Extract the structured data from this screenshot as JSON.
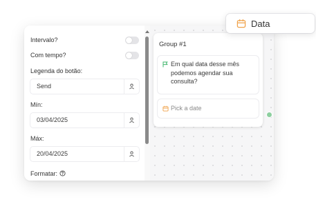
{
  "properties": {
    "interval_label": "Intervalo?",
    "with_time_label": "Com tempo?",
    "button_caption_label": "Legenda do botão:",
    "button_caption_value": "Send",
    "min_label": "Mín:",
    "min_value": "03/04/2025",
    "max_label": "Máx:",
    "max_value": "20/04/2025",
    "format_label": "Formatar:"
  },
  "group": {
    "title": "Group #1",
    "message": "Em qual data desse mês podemos agendar sua consulta?",
    "date_placeholder": "Pick a date"
  },
  "floating_block": {
    "label": "Data"
  },
  "colors": {
    "accent_orange": "#f0a24a",
    "accent_green": "#3fb56b"
  },
  "icons": {
    "variable": "user-icon",
    "help": "help-circle-icon",
    "message": "flag-icon",
    "date": "calendar-icon"
  }
}
